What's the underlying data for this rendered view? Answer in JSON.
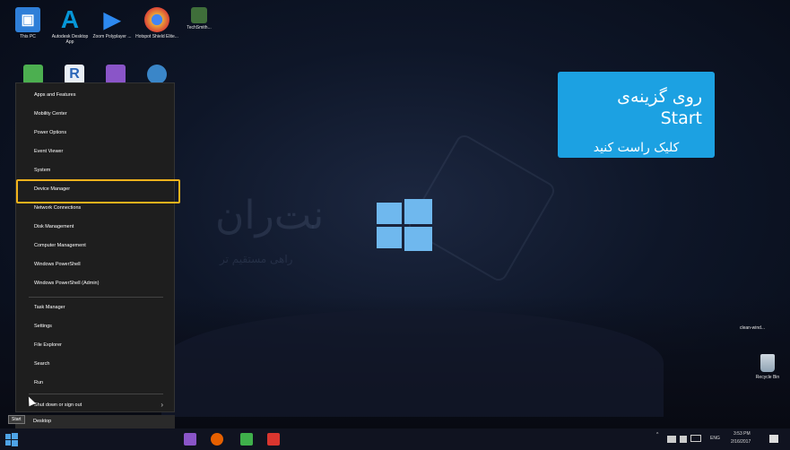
{
  "desktop": {
    "top_icons": [
      {
        "label": "This PC",
        "icon": "computer-icon",
        "color": "#2f7fd8"
      },
      {
        "label": "Autodesk Desktop App",
        "icon": "autodesk-icon",
        "color": "#0696d7"
      },
      {
        "label": "Zoom Polyplayer ...",
        "icon": "player-icon",
        "color": "#2d89ef"
      },
      {
        "label": "Hotspot Shield Elite...",
        "icon": "chrome-icon",
        "color": "#e8a53a"
      },
      {
        "label": "TechSmith...",
        "icon": "techsmith-icon",
        "color": "#3f6e3a"
      }
    ],
    "second_row_icons": [
      {
        "label": "",
        "icon": "green-app-icon",
        "color": "#4caf50"
      },
      {
        "label": "R",
        "icon": "r-app-icon",
        "color": "#e8eef6"
      },
      {
        "label": "",
        "icon": "visual-studio-icon",
        "color": "#8a55c8"
      },
      {
        "label": "",
        "icon": "browser-icon",
        "color": "#3a86c8"
      }
    ],
    "watermark_title": "نت‌ران",
    "watermark_subtitle": "راهی مستقیم تر",
    "recycle_bin_label": "Recycle Bin",
    "clean_label": "clean-wind..."
  },
  "context_menu": {
    "items": [
      {
        "label": "Apps and Features"
      },
      {
        "label": "Mobility Center"
      },
      {
        "label": "Power Options"
      },
      {
        "label": "Event Viewer"
      },
      {
        "label": "System"
      },
      {
        "label": "Device Manager"
      },
      {
        "label": "Network Connections"
      },
      {
        "label": "Disk Management"
      },
      {
        "label": "Computer Management"
      },
      {
        "label": "Windows PowerShell"
      },
      {
        "label": "Windows PowerShell (Admin)"
      },
      {
        "label": "Task Manager"
      },
      {
        "label": "Settings"
      },
      {
        "label": "File Explorer"
      },
      {
        "label": "Search"
      },
      {
        "label": "Run"
      },
      {
        "label": "Shut down or sign out"
      },
      {
        "label": "Desktop"
      }
    ],
    "highlighted": "Device Manager",
    "highlight_color": "#f0b21c"
  },
  "callout": {
    "line1": "روی گزینه‌ی Start",
    "line2": "کلیک راست کنید",
    "color": "#1ca1e2"
  },
  "taskbar": {
    "tooltip": "Start",
    "language": "ENG",
    "time": "3:53 PM",
    "date": "2/16/2017",
    "pinned": [
      {
        "icon": "visual-studio-icon",
        "color": "#8a55c8"
      },
      {
        "icon": "firefox-icon",
        "color": "#e66000"
      },
      {
        "icon": "camtasia-icon",
        "color": "#3fb04b"
      },
      {
        "icon": "red-app-icon",
        "color": "#d9362f"
      }
    ]
  }
}
